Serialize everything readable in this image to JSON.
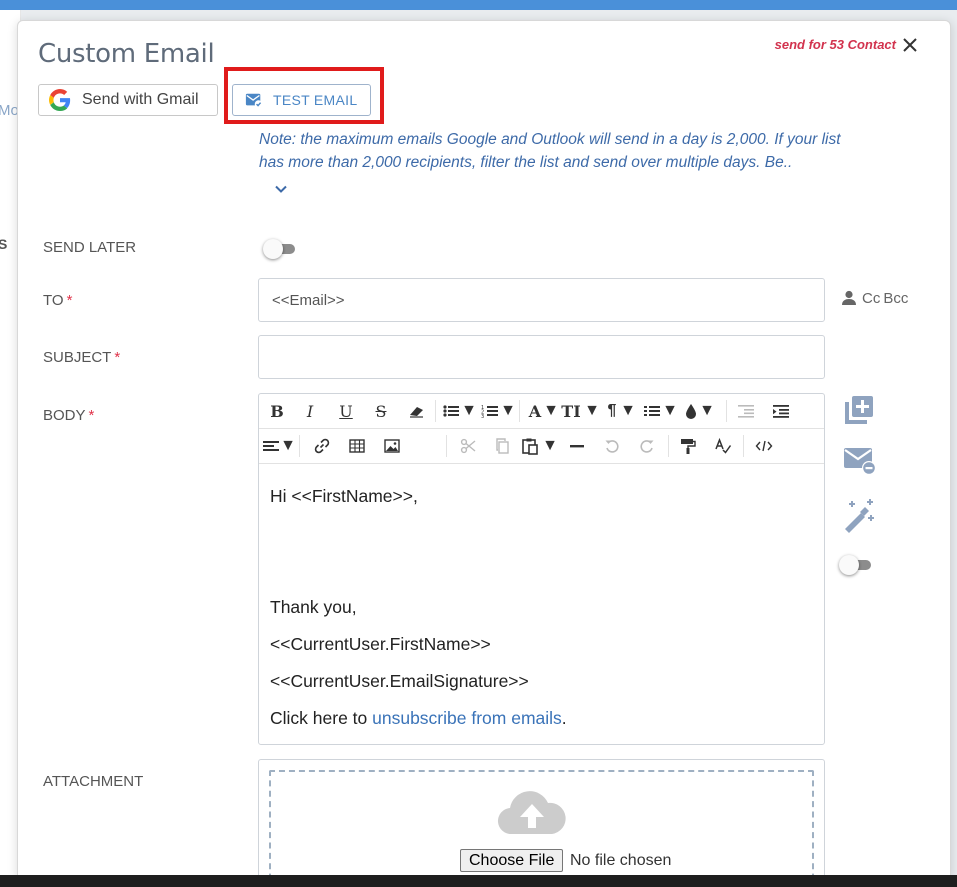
{
  "background": {
    "fragment_top": "Mo",
    "fragment_mid": "S"
  },
  "modal": {
    "title": "Custom Email",
    "send_for": "send for 53 Contact",
    "gmail_button_label": "Send with Gmail",
    "test_email_label": "TEST EMAIL",
    "note_line1": "Note: the maximum emails Google and Outlook will send in a day is 2,000.  If your list",
    "note_line2": "has more than 2,000 recipients, filter the list and send over multiple days.  Be.."
  },
  "form": {
    "send_later_label": "SEND LATER",
    "to_label": "TO",
    "to_value": "<<Email>>",
    "subject_label": "SUBJECT",
    "subject_value": "",
    "body_label": "BODY",
    "attachment_label": "ATTACHMENT",
    "required_mark": "*",
    "cc": "Cc",
    "bcc": "Bcc"
  },
  "body": {
    "line1": "Hi <<FirstName>>,",
    "line2": "Thank you,",
    "line3": "<<CurrentUser.FirstName>>",
    "line4": "<<CurrentUser.EmailSignature>>",
    "line5_prefix": "Click here to ",
    "line5_link": "unsubscribe from emails",
    "line5_suffix": "."
  },
  "attachment": {
    "choose_file": "Choose File",
    "no_file": "No file chosen"
  },
  "toolbar": {
    "bold": "B",
    "italic": "I",
    "underline": "U",
    "strike": "S",
    "font": "A",
    "font_size": "TI",
    "paragraph": "¶",
    "caret": "▼"
  },
  "colors": {
    "accent": "#4a86c5",
    "required": "#e0334a",
    "send_for": "#d2334e",
    "highlight": "#e01b1b",
    "note": "#3d6aa8",
    "link": "#3a73b8"
  }
}
